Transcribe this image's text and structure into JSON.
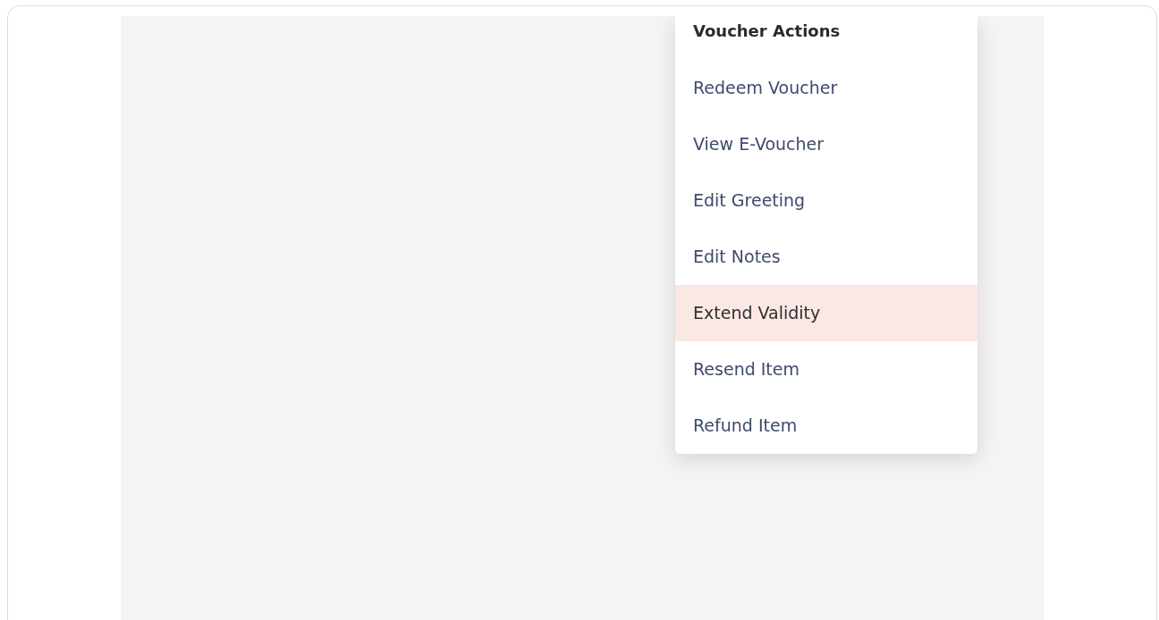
{
  "menu": {
    "title": "Voucher Actions",
    "items": [
      {
        "label": "Redeem Voucher",
        "selected": false
      },
      {
        "label": "View E-Voucher",
        "selected": false
      },
      {
        "label": "Edit Greeting",
        "selected": false
      },
      {
        "label": "Edit Notes",
        "selected": false
      },
      {
        "label": "Extend Validity",
        "selected": true
      },
      {
        "label": "Resend Item",
        "selected": false
      },
      {
        "label": "Refund Item",
        "selected": false
      }
    ]
  }
}
